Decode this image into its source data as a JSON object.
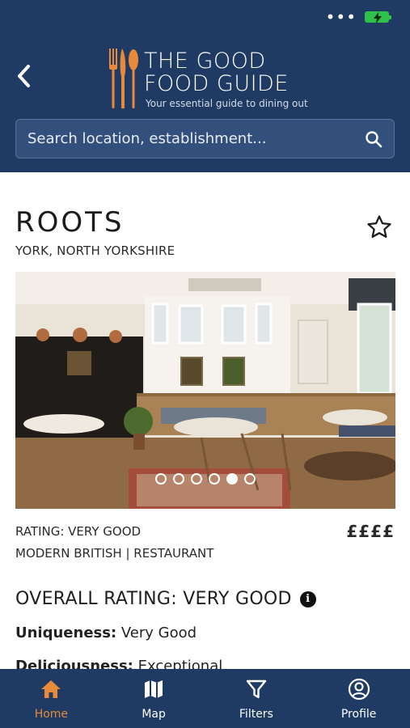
{
  "colors": {
    "navy": "#1f3a63",
    "accent": "#e98a3a",
    "battery": "#2ec24a"
  },
  "status": {
    "icon": "battery-charging-icon"
  },
  "header": {
    "back_icon": "chevron-left-icon",
    "logo": {
      "title_line1": "THE GOOD",
      "title_line2": "FOOD GUIDE",
      "tagline": "Your essential guide to dining out"
    },
    "search": {
      "placeholder": "Search location, establishment...",
      "icon": "search-icon"
    }
  },
  "restaurant": {
    "name": "ROOTS",
    "location": "YORK, NORTH YORKSHIRE",
    "favorite_icon": "star-outline-icon",
    "photo": {
      "slides": 6,
      "active_slide": 5
    },
    "rating_line": "RATING: VERY GOOD",
    "cuisine_line": "MODERN BRITISH | RESTAURANT",
    "price": "££££"
  },
  "overall": {
    "heading": "OVERALL RATING: VERY GOOD",
    "info_icon": "info-icon",
    "items": [
      {
        "label": "Uniqueness:",
        "value": "Very Good"
      },
      {
        "label": "Deliciousness:",
        "value": "Exceptional"
      }
    ]
  },
  "tabbar": {
    "tabs": [
      {
        "label": "Home",
        "icon": "home-icon",
        "active": true
      },
      {
        "label": "Map",
        "icon": "map-icon",
        "active": false
      },
      {
        "label": "Filters",
        "icon": "filter-icon",
        "active": false
      },
      {
        "label": "Profile",
        "icon": "profile-icon",
        "active": false
      }
    ]
  }
}
